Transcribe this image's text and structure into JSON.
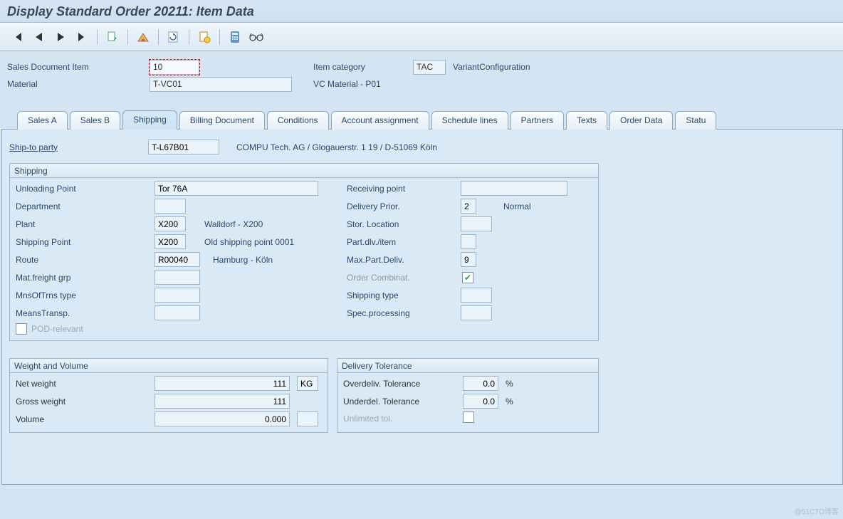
{
  "title": "Display Standard Order 20211: Item Data",
  "header": {
    "sales_doc_item_label": "Sales Document Item",
    "sales_doc_item_value": "10",
    "material_label": "Material",
    "material_value": "T-VC01",
    "item_category_label": "Item category",
    "item_category_value": "TAC",
    "item_category_desc": "VariantConfiguration",
    "material_desc": "VC Material  - P01"
  },
  "tabs": [
    "Sales A",
    "Sales B",
    "Shipping",
    "Billing Document",
    "Conditions",
    "Account assignment",
    "Schedule lines",
    "Partners",
    "Texts",
    "Order Data",
    "Statu"
  ],
  "active_tab_index": 2,
  "shipto": {
    "label": "Ship-to party",
    "value": "T-L67B01",
    "address": "COMPU Tech. AG / Glogauerstr. 1 19 / D-51069 Köln"
  },
  "shipping_group_title": "Shipping",
  "shipping": {
    "unloading_point_label": "Unloading Point",
    "unloading_point_value": "Tor 76A",
    "receiving_point_label": "Receiving point",
    "receiving_point_value": "",
    "department_label": "Department",
    "department_value": "",
    "delivery_prior_label": "Delivery Prior.",
    "delivery_prior_value": "2",
    "delivery_prior_desc": "Normal",
    "plant_label": "Plant",
    "plant_value": "X200",
    "plant_desc": "Walldorf - X200",
    "stor_location_label": "Stor. Location",
    "stor_location_value": "",
    "shipping_point_label": "Shipping Point",
    "shipping_point_value": "X200",
    "shipping_point_desc": "Old shipping point 0001",
    "part_dlv_label": "Part.dlv./item",
    "part_dlv_value": "",
    "route_label": "Route",
    "route_value": "R00040",
    "route_desc": "Hamburg - Köln",
    "max_part_deliv_label": "Max.Part.Deliv.",
    "max_part_deliv_value": "9",
    "mat_freight_label": "Mat.freight grp",
    "mat_freight_value": "",
    "order_combinat_label": "Order Combinat.",
    "order_combinat_checked": true,
    "mns_of_trns_label": "MnsOfTrns type",
    "mns_of_trns_value": "",
    "shipping_type_label": "Shipping type",
    "shipping_type_value": "",
    "means_transp_label": "MeansTransp.",
    "means_transp_value": "",
    "spec_processing_label": "Spec.processing",
    "spec_processing_value": "",
    "pod_relevant_label": "POD-relevant",
    "pod_relevant_checked": false
  },
  "weight_volume_title": "Weight and Volume",
  "weight_volume": {
    "net_weight_label": "Net weight",
    "net_weight_value": "111",
    "net_weight_unit": "KG",
    "gross_weight_label": "Gross weight",
    "gross_weight_value": "111",
    "volume_label": "Volume",
    "volume_value": "0.000"
  },
  "delivery_tolerance_title": "Delivery Tolerance",
  "delivery_tolerance": {
    "overdeliv_label": "Overdeliv. Tolerance",
    "overdeliv_value": "0.0",
    "percent": "%",
    "underdel_label": "Underdel. Tolerance",
    "underdel_value": "0.0",
    "unlimited_label": "Unlimited tol.",
    "unlimited_checked": false
  },
  "watermark": "@51CTO博客"
}
